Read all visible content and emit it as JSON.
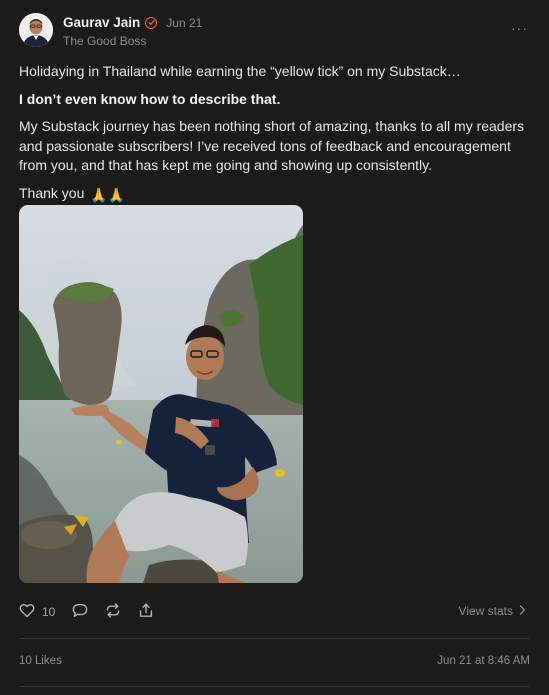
{
  "post": {
    "author": "Gaurav Jain",
    "date": "Jun 21",
    "publication": "The Good Boss",
    "more_label": "···"
  },
  "content": {
    "line1": "Holidaying in Thailand while earning the “yellow tick” on my Substack…",
    "line2": "I don’t even know how to describe that.",
    "line3": "My Substack journey has been nothing short of amazing, thanks to all my readers and passionate subscribers! I’ve received tons of feedback and encouragement from you, and that has kept me going and showing up consistently.",
    "line4": "Thank you",
    "emoji": "🙏🙏"
  },
  "actions": {
    "like_count": "10",
    "view_stats": "View stats"
  },
  "footer": {
    "likes": "10 Likes",
    "timestamp": "Jun 21 at 8:46 AM"
  },
  "colors": {
    "background": "#1b1b1b",
    "badge": "#ff6719",
    "muted_text": "#8d8d8d"
  },
  "icons": [
    "heart-icon",
    "comment-icon",
    "restack-icon",
    "share-icon",
    "chevron-right-icon",
    "verified-badge-icon",
    "more-icon"
  ]
}
